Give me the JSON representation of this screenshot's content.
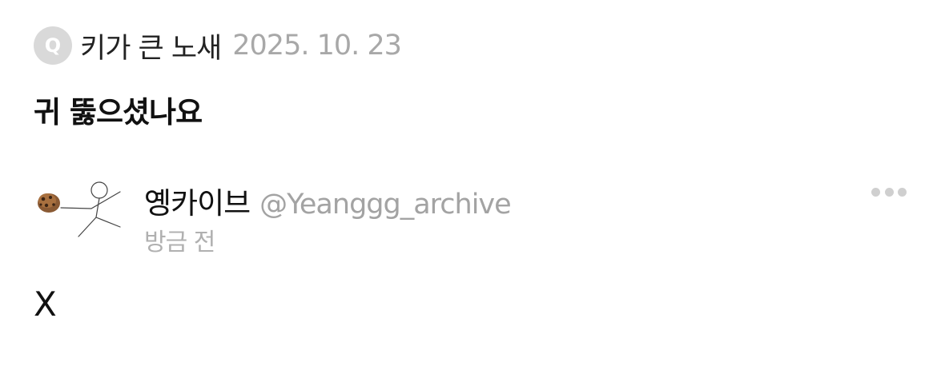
{
  "question": {
    "badge": "Q",
    "asker": "키가 큰 노새",
    "date": "2025. 10. 23",
    "text": "귀 뚫으셨나요"
  },
  "answer": {
    "avatar_icon": "stick-figure-holding-cookie-icon",
    "name": "옝카이브",
    "handle": "@Yeanggg_archive",
    "time": "방금 전",
    "more_icon": "more-horizontal-icon",
    "text": "X"
  },
  "colors": {
    "badge_bg": "#d9d9d9",
    "secondary_text": "#a8a8a8",
    "dots": "#cfcfcf"
  }
}
